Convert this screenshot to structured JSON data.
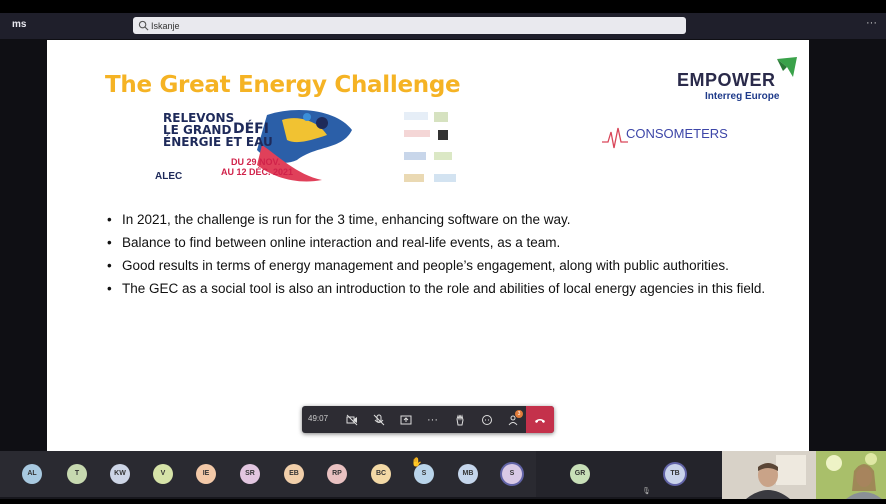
{
  "app": {
    "name": "ms"
  },
  "search": {
    "value": "Iskanje"
  },
  "slide": {
    "title": "The Great Energy Challenge",
    "logos": {
      "empower_main": "EMPOWER",
      "empower_sub": "Interreg Europe",
      "consometers": "CONSOMETERS"
    },
    "poster": {
      "line1": "RELEVONS",
      "line2": "LE GRAND",
      "line3": "ÉNERGIE ET EAU",
      "defi": "DÉFI",
      "dates_line1": "DU 29 NOV.",
      "dates_line2": "AU 12 DÉC. 2021",
      "org": "ALEC"
    },
    "bullets": [
      "In 2021, the challenge is run for the 3   time, enhancing software on the way.",
      "Balance to find between online interaction and real-life events, as a team.",
      "Good results in terms of energy management and people’s engagement, along with public authorities.",
      "The GEC as a social tool is also an introduction to the role and abilities of local energy agencies in this field."
    ]
  },
  "toolbar": {
    "timer": "49:07",
    "participants_badge": "3"
  },
  "gallery": {
    "participants": [
      {
        "initials": "AL",
        "color": "#a8c9e0"
      },
      {
        "initials": "T",
        "color": "#c7d9b0"
      },
      {
        "initials": "KW",
        "color": "#cdd5e6"
      },
      {
        "initials": "V",
        "color": "#d6e3a8"
      },
      {
        "initials": "IE",
        "color": "#f3c9a8"
      },
      {
        "initials": "SR",
        "color": "#e2c6e0"
      },
      {
        "initials": "EB",
        "color": "#f1cfaa"
      },
      {
        "initials": "RP",
        "color": "#e9c1c1"
      },
      {
        "initials": "BC",
        "color": "#f3d9a6"
      },
      {
        "initials": "S",
        "color": "#b9d4ea"
      },
      {
        "initials": "MB",
        "color": "#c5d6ec"
      },
      {
        "initials": "S",
        "color": "#d9c9e6"
      },
      {
        "initials": "GR",
        "color": "#c8dfb8"
      },
      {
        "initials": "TB",
        "color": "#c9d3ea"
      }
    ]
  }
}
